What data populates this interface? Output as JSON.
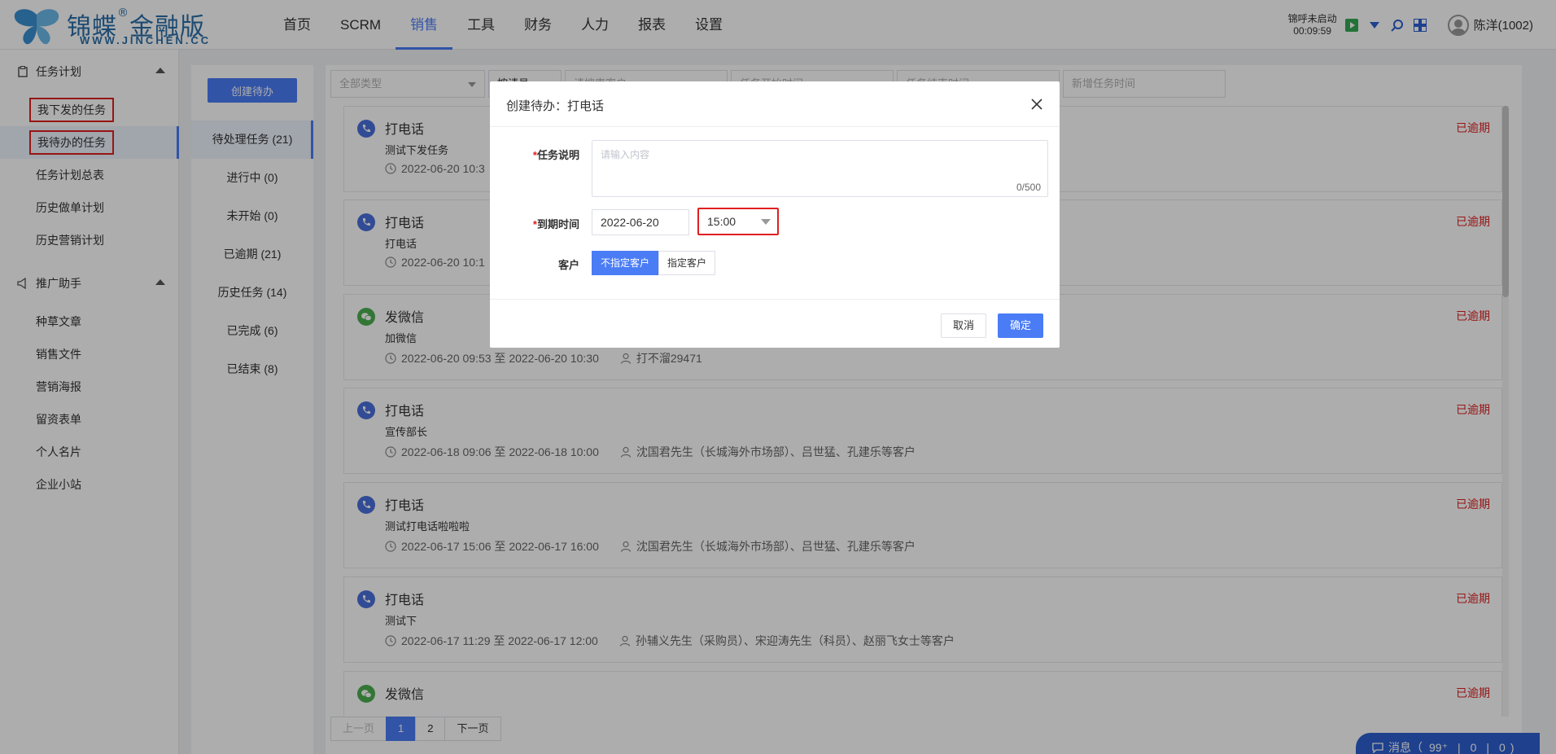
{
  "header": {
    "brand": "锦蝶",
    "brand_suffix": "金融版",
    "site": "WWW.JINCHEN.CC",
    "nav": [
      "首页",
      "SCRM",
      "销售",
      "工具",
      "财务",
      "人力",
      "报表",
      "设置"
    ],
    "active_nav": "销售",
    "call_status": "锦呼未启动",
    "call_timer": "00:09:59",
    "user_name": "陈洋(1002)"
  },
  "sidebar": {
    "group1": "任务计划",
    "group1_items": [
      "我下发的任务",
      "我待办的任务",
      "任务计划总表",
      "历史做单计划",
      "历史营销计划"
    ],
    "group2": "推广助手",
    "group2_items": [
      "种草文章",
      "销售文件",
      "营销海报",
      "留资表单",
      "个人名片",
      "企业小站"
    ]
  },
  "col2": {
    "create_label": "创建待办",
    "statuses": [
      "待处理任务 (21)",
      "进行中 (0)",
      "未开始 (0)",
      "已逾期 (21)",
      "历史任务 (14)",
      "已完成 (6)",
      "已结束 (8)"
    ]
  },
  "filters": {
    "type": "全部类型",
    "handler": "按请员",
    "search": "请搜索客户",
    "start": "任务开始时间",
    "end": "任务结束时间",
    "new_time": "新增任务时间"
  },
  "cards": [
    {
      "title": "打电话",
      "desc": "测试下发任务",
      "time": "2022-06-20 10:3",
      "customer": "",
      "status": "已逾期",
      "kind": "phone"
    },
    {
      "title": "打电话",
      "desc": "打电话",
      "time": "2022-06-20 10:1",
      "customer": "",
      "status": "已逾期",
      "kind": "phone"
    },
    {
      "title": "发微信",
      "desc": "加微信",
      "time": "2022-06-20 09:53 至 2022-06-20 10:30",
      "customer": "打不溜29471",
      "status": "已逾期",
      "kind": "wechat"
    },
    {
      "title": "打电话",
      "desc": "宣传部长",
      "time": "2022-06-18 09:06 至 2022-06-18 10:00",
      "customer": "沈国君先生（长城海外市场部）、吕世猛、孔建乐等客户",
      "status": "已逾期",
      "kind": "phone"
    },
    {
      "title": "打电话",
      "desc": "测试打电话啦啦啦",
      "time": "2022-06-17 15:06 至 2022-06-17 16:00",
      "customer": "沈国君先生（长城海外市场部）、吕世猛、孔建乐等客户",
      "status": "已逾期",
      "kind": "phone"
    },
    {
      "title": "打电话",
      "desc": "测试下",
      "time": "2022-06-17 11:29 至 2022-06-17 12:00",
      "customer": "孙辅义先生（采购员）、宋迎涛先生（科员）、赵丽飞女士等客户",
      "status": "已逾期",
      "kind": "phone"
    },
    {
      "title": "发微信",
      "desc": "",
      "time": "",
      "customer": "",
      "status": "已逾期",
      "kind": "wechat"
    }
  ],
  "pager": {
    "prev": "上一页",
    "pages": [
      "1",
      "2"
    ],
    "current": "1",
    "next": "下一页"
  },
  "messages": {
    "label": "消息（",
    "count": "99⁺",
    "n2": "0",
    "n3": "0",
    "close": ")"
  },
  "modal": {
    "title": "创建待办：打电话",
    "desc_label": "任务说明",
    "desc_placeholder": "请输入内容",
    "desc_count": "0/500",
    "due_label": "到期时间",
    "due_date": "2022-06-20",
    "due_time": "15:00",
    "customer_label": "客户",
    "customer_opt1": "不指定客户",
    "customer_opt2": "指定客户",
    "cancel": "取消",
    "ok": "确定"
  },
  "colors": {
    "accent": "#4a7cf6",
    "overdue": "#e02020",
    "highlight": "#e02020"
  }
}
